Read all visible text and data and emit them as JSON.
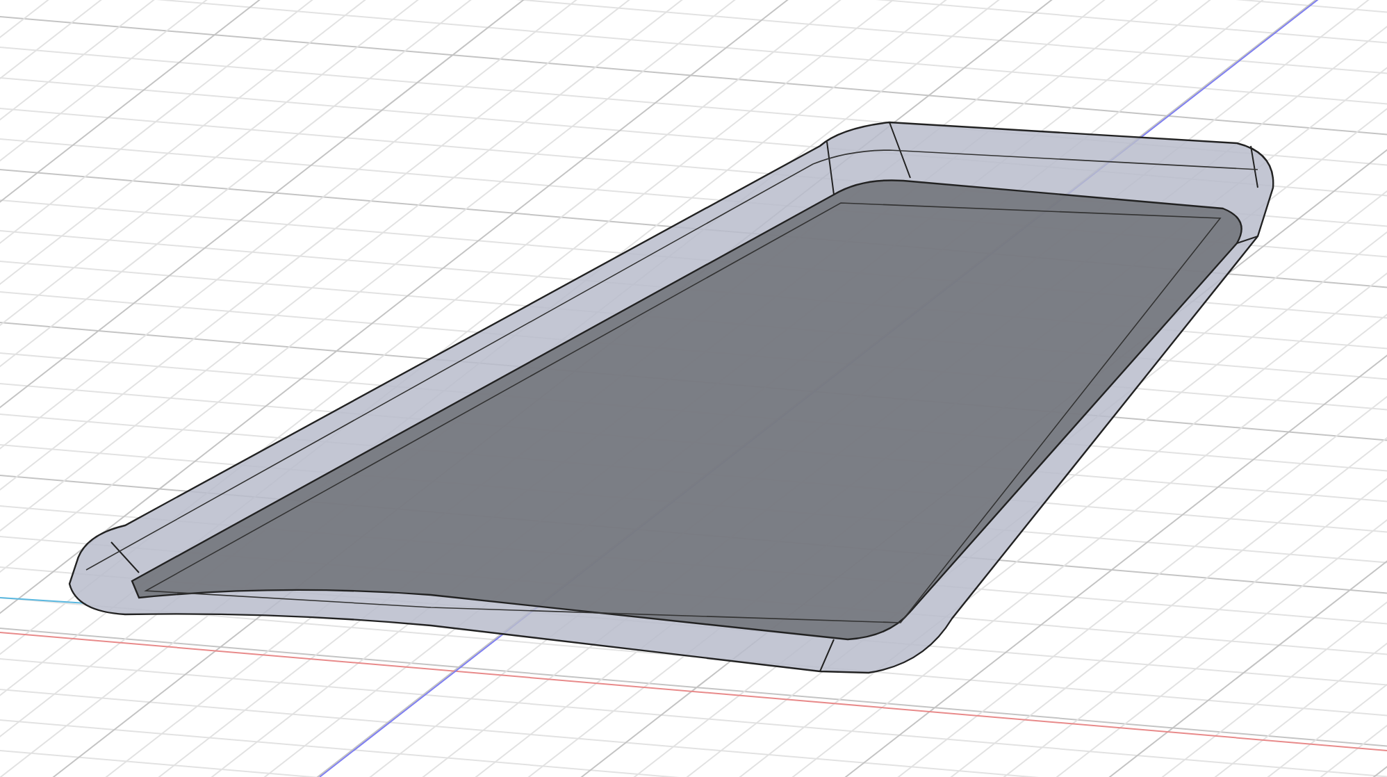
{
  "viewport": {
    "grid": true,
    "axes": true,
    "model": {
      "kind": "panel"
    }
  }
}
